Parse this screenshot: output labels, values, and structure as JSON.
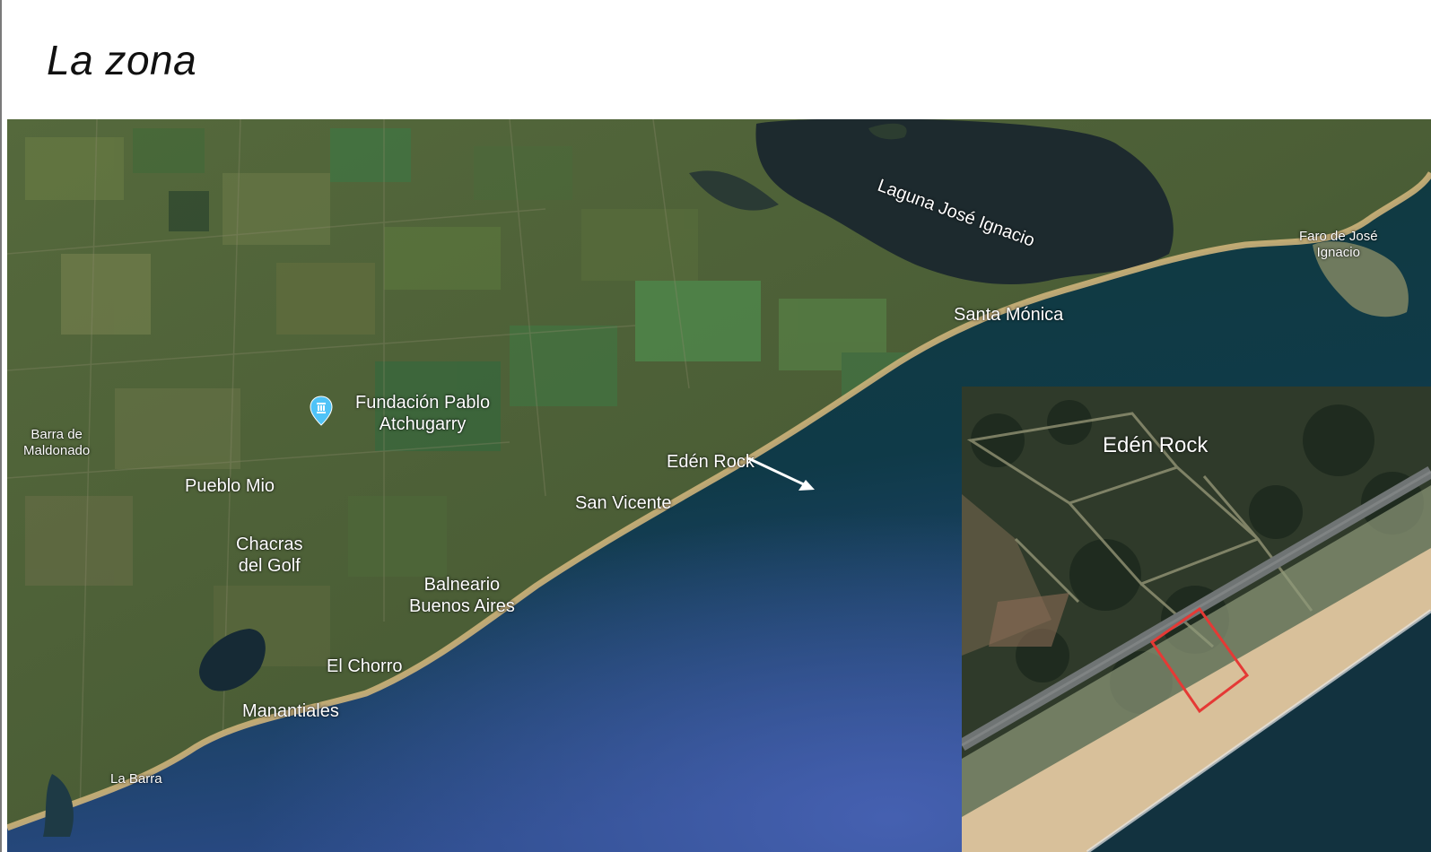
{
  "page": {
    "title": "La zona"
  },
  "map": {
    "labels": {
      "laguna": "Laguna José Ignacio",
      "faro_line1": "Faro de José",
      "faro_line2": "Ignacio",
      "santa_monica": "Santa Mónica",
      "fundacion_line1": "Fundación Pablo",
      "fundacion_line2": "Atchugarry",
      "barra_maldonado_line1": "Barra de",
      "barra_maldonado_line2": "Maldonado",
      "pueblo_mio": "Pueblo Mio",
      "chacras_line1": "Chacras",
      "chacras_line2": "del Golf",
      "eden_rock": "Edén Rock",
      "san_vicente": "San Vicente",
      "balneario_line1": "Balneario",
      "balneario_line2": "Buenos Aires",
      "el_chorro": "El Chorro",
      "manantiales": "Manantiales",
      "la_barra": "La Barra"
    },
    "icons": {
      "poi": "museum-pin-icon",
      "pointer": "arrow-icon"
    },
    "colors": {
      "pin": "#4fc3f7",
      "lot_outline": "#e53935"
    }
  },
  "inset": {
    "label": "Edén Rock",
    "icons": {
      "lot": "lot-outline-icon"
    }
  }
}
